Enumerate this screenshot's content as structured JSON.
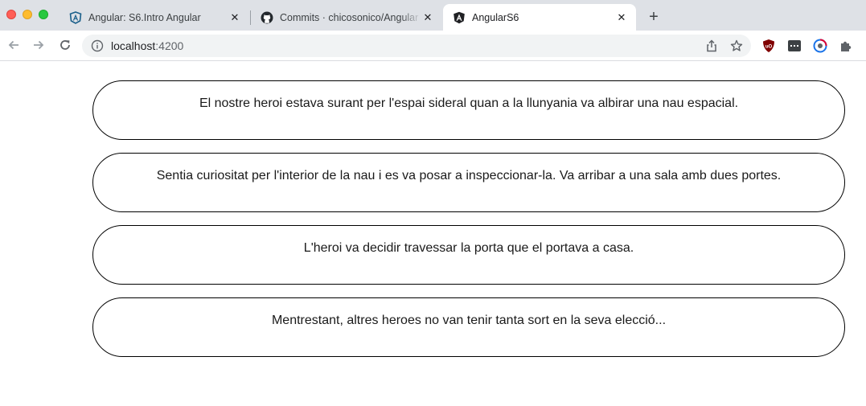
{
  "browser": {
    "tabs": [
      {
        "title": "Angular: S6.Intro Angular",
        "icon": "angular-outline-icon"
      },
      {
        "title": "Commits · chicosonico/Angular",
        "icon": "github-icon"
      },
      {
        "title": "AngularS6",
        "icon": "angular-icon",
        "active": true
      }
    ],
    "new_tab_label": "+",
    "close_label": "✕",
    "address": {
      "host": "localhost",
      "port": ":4200"
    }
  },
  "story": {
    "scenes": [
      "El nostre heroi estava surant per l'espai sideral quan a la llunyania va albirar una nau espacial.",
      "Sentia curiositat per l'interior de la nau i es va posar a inspeccionar-la. Va arribar a una sala amb dues portes.",
      "L'heroi va decidir travessar la porta que el portava a casa.",
      "Mentrestant, altres heroes no van tenir tanta sort en la seva elecció..."
    ]
  },
  "colors": {
    "tabstrip": "#dee1e6",
    "omnibox": "#f1f3f4",
    "scene_border": "#000000",
    "ublock": "#800000",
    "angular": "#dd0031"
  }
}
